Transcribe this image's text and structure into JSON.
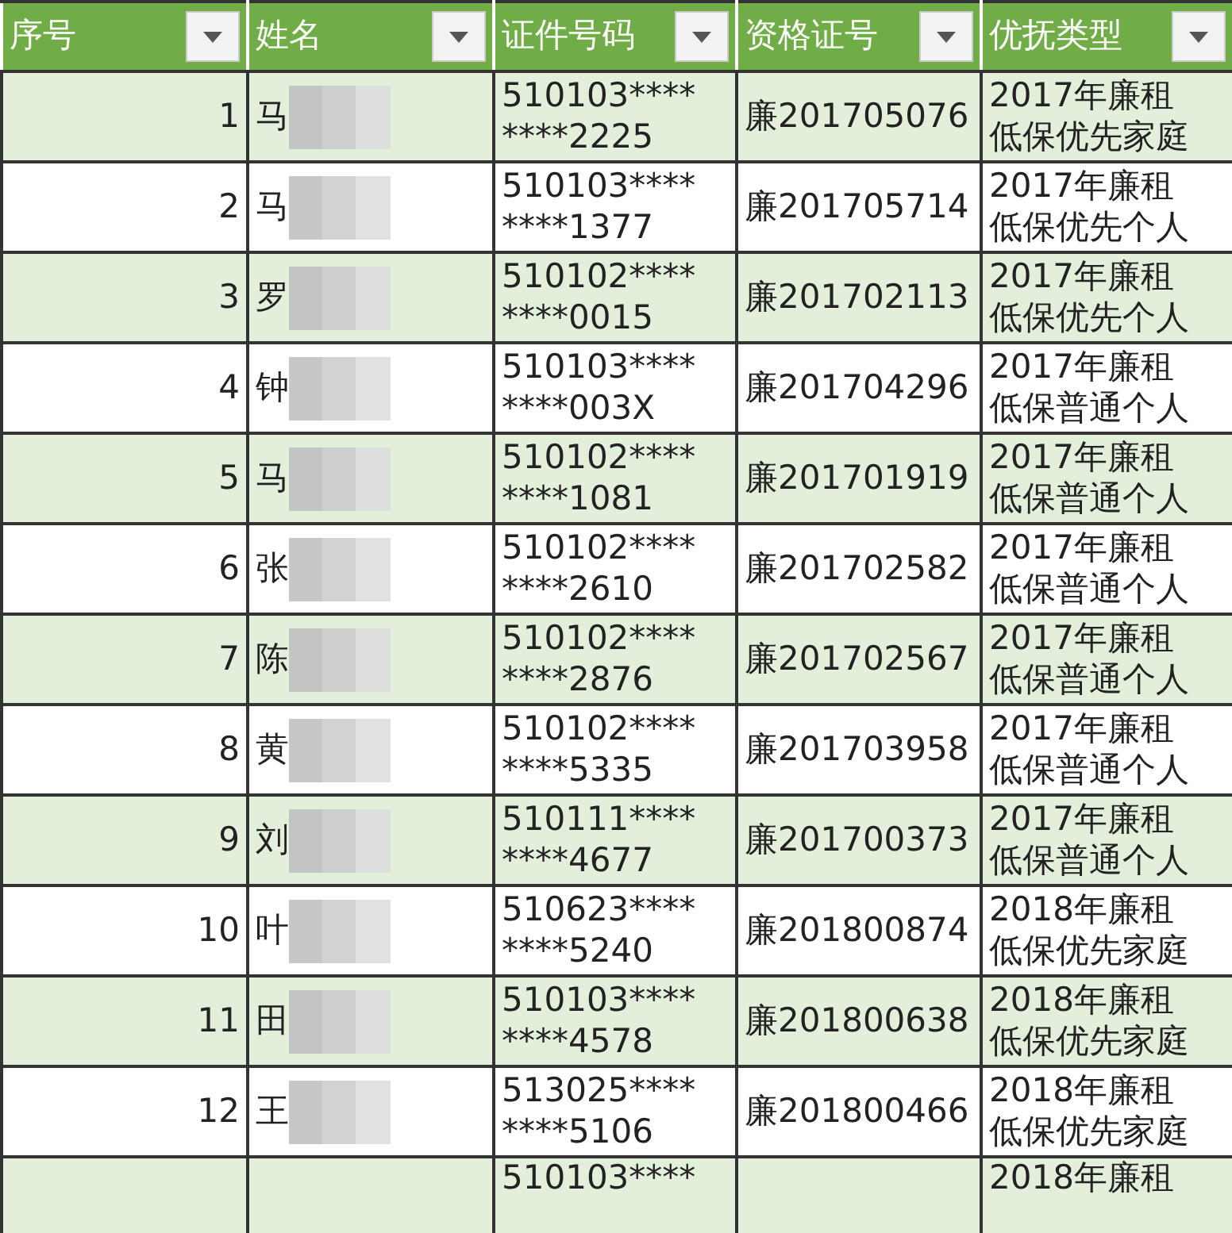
{
  "table": {
    "columns": [
      "序号",
      "姓名",
      "证件号码",
      "资格证号",
      "优抚类型"
    ],
    "rows": [
      {
        "seq": "1",
        "name": "马",
        "id": [
          "510103****",
          "****2225"
        ],
        "cert": "廉201705076",
        "type": [
          "2017年廉租",
          "低保优先家庭"
        ]
      },
      {
        "seq": "2",
        "name": "马",
        "id": [
          "510103****",
          "****1377"
        ],
        "cert": "廉201705714",
        "type": [
          "2017年廉租",
          "低保优先个人"
        ]
      },
      {
        "seq": "3",
        "name": "罗",
        "id": [
          "510102****",
          "****0015"
        ],
        "cert": "廉201702113",
        "type": [
          "2017年廉租",
          "低保优先个人"
        ]
      },
      {
        "seq": "4",
        "name": "钟",
        "id": [
          "510103****",
          "****003X"
        ],
        "cert": "廉201704296",
        "type": [
          "2017年廉租",
          "低保普通个人"
        ]
      },
      {
        "seq": "5",
        "name": "马",
        "id": [
          "510102****",
          "****1081"
        ],
        "cert": "廉201701919",
        "type": [
          "2017年廉租",
          "低保普通个人"
        ]
      },
      {
        "seq": "6",
        "name": "张",
        "id": [
          "510102****",
          "****2610"
        ],
        "cert": "廉201702582",
        "type": [
          "2017年廉租",
          "低保普通个人"
        ]
      },
      {
        "seq": "7",
        "name": "陈",
        "id": [
          "510102****",
          "****2876"
        ],
        "cert": "廉201702567",
        "type": [
          "2017年廉租",
          "低保普通个人"
        ]
      },
      {
        "seq": "8",
        "name": "黄",
        "id": [
          "510102****",
          "****5335"
        ],
        "cert": "廉201703958",
        "type": [
          "2017年廉租",
          "低保普通个人"
        ]
      },
      {
        "seq": "9",
        "name": "刘",
        "id": [
          "510111****",
          "****4677"
        ],
        "cert": "廉201700373",
        "type": [
          "2017年廉租",
          "低保普通个人"
        ]
      },
      {
        "seq": "10",
        "name": "叶",
        "id": [
          "510623****",
          "****5240"
        ],
        "cert": "廉201800874",
        "type": [
          "2018年廉租",
          "低保优先家庭"
        ]
      },
      {
        "seq": "11",
        "name": "田",
        "id": [
          "510103****",
          "****4578"
        ],
        "cert": "廉201800638",
        "type": [
          "2018年廉租",
          "低保优先家庭"
        ]
      },
      {
        "seq": "12",
        "name": "王",
        "id": [
          "513025****",
          "****5106"
        ],
        "cert": "廉201800466",
        "type": [
          "2018年廉租",
          "低保优先家庭"
        ]
      },
      {
        "id": [
          "510103****"
        ],
        "type": [
          "2018年廉租"
        ]
      }
    ]
  }
}
